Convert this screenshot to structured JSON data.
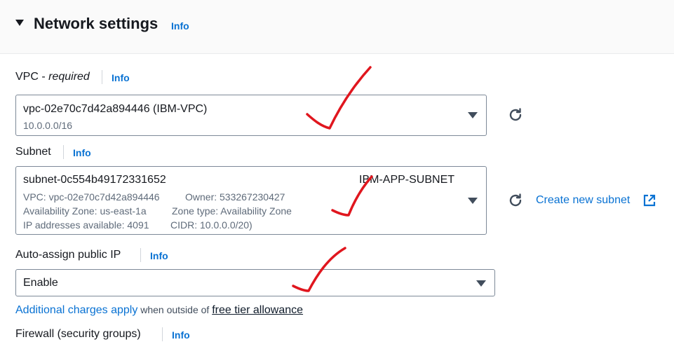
{
  "section": {
    "title": "Network settings",
    "info": "Info"
  },
  "vpc": {
    "label": "VPC - ",
    "required": "required",
    "info": "Info",
    "value": "vpc-02e70c7d42a894446 (IBM-VPC)",
    "cidr": "10.0.0.0/16"
  },
  "subnet": {
    "label": "Subnet",
    "info": "Info",
    "value": "subnet-0c554b49172331652",
    "name": "IBM-APP-SUBNET",
    "vpc_line": "VPC: vpc-02e70c7d42a894446",
    "owner_line": "Owner: 533267230427",
    "az_line": "Availability Zone: us-east-1a",
    "zone_type_line": "Zone type: Availability Zone",
    "ip_line": "IP addresses available: 4091",
    "cidr_line": "CIDR: 10.0.0.0/20)",
    "create_link": "Create new subnet"
  },
  "auto_assign": {
    "label": "Auto-assign public IP",
    "info": "Info",
    "value": "Enable"
  },
  "footnote": {
    "prefix": "Additional charges apply",
    "middle": " when outside of ",
    "link": "free tier allowance"
  },
  "firewall": {
    "label": "Firewall (security groups)",
    "info": "Info"
  },
  "colors": {
    "accent": "#0972d3",
    "annotation": "#e0161e"
  }
}
